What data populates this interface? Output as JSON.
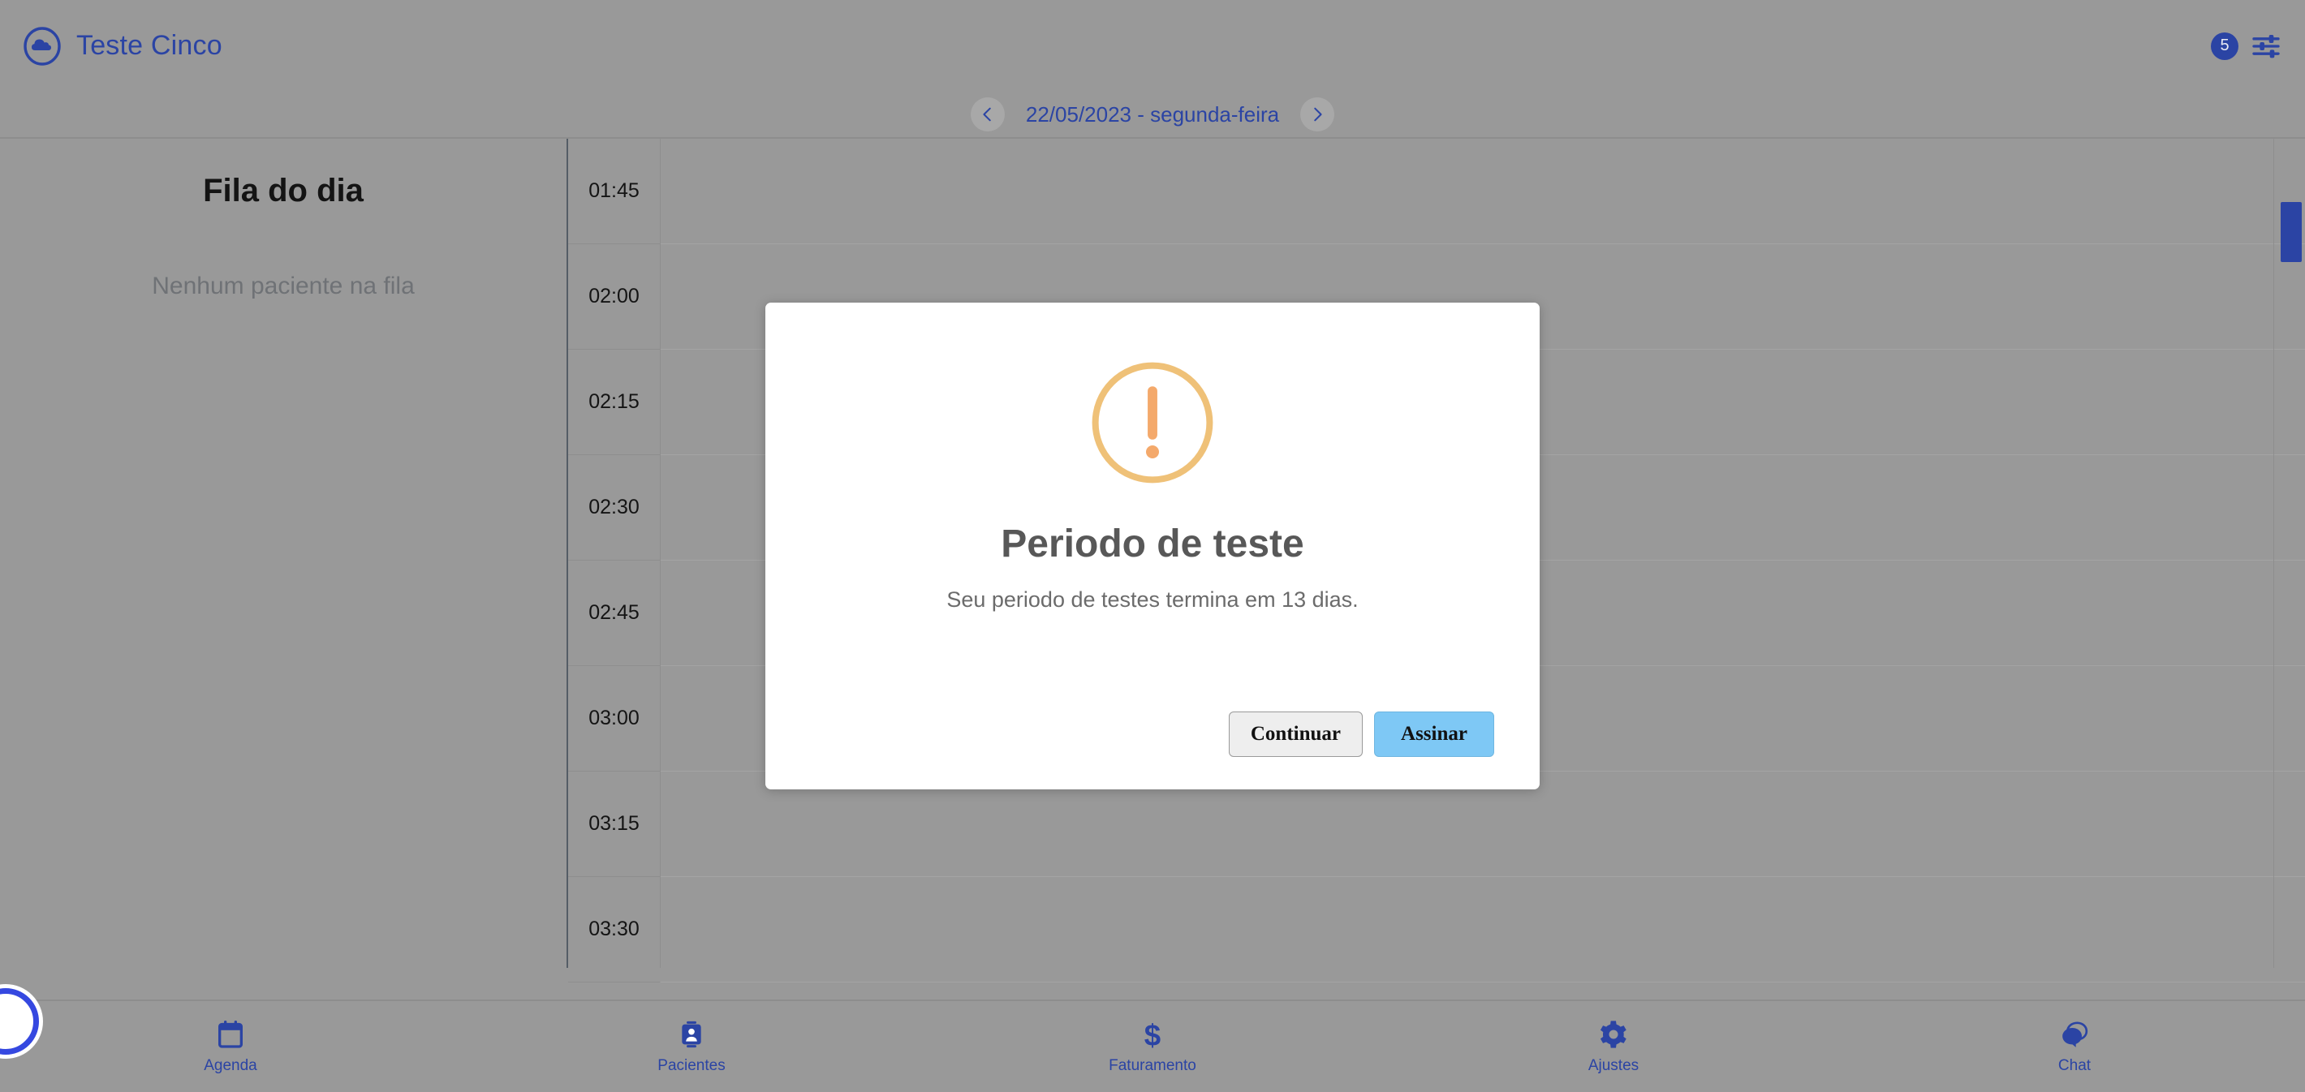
{
  "colors": {
    "page_bg": "#999999",
    "brand_blue": "#2b44a4",
    "accent_blue": "#3548e0",
    "warn_orange": "#efc178",
    "primary_button": "#7ec8f5",
    "scrollbar": "#2b44a4"
  },
  "header": {
    "logo_icon": "cloud-circle-icon",
    "title": "Teste Cinco",
    "notification_count": "5",
    "settings_icon": "tune-sliders-icon"
  },
  "datebar": {
    "prev_icon": "chevron-left-icon",
    "next_icon": "chevron-right-icon",
    "current_date": "22/05/2023 - segunda-feira"
  },
  "queue": {
    "title": "Fila do dia",
    "empty_message": "Nenhum paciente na fila"
  },
  "schedule": {
    "time_slots": [
      "01:45",
      "02:00",
      "02:15",
      "02:30",
      "02:45",
      "03:00",
      "03:15",
      "03:30"
    ]
  },
  "bottom_nav": {
    "items": [
      {
        "label": "Agenda",
        "icon": "calendar-icon"
      },
      {
        "label": "Pacientes",
        "icon": "contact-card-icon"
      },
      {
        "label": "Faturamento",
        "icon": "dollar-sign-icon"
      },
      {
        "label": "Ajustes",
        "icon": "gear-icon"
      },
      {
        "label": "Chat",
        "icon": "chat-bubbles-icon"
      }
    ]
  },
  "fab": {
    "icon": "floating-action-circle-icon"
  },
  "modal": {
    "icon": "warning-exclamation-icon",
    "title": "Periodo de teste",
    "message": "Seu periodo de testes termina em 13 dias.",
    "secondary_button": "Continuar",
    "primary_button": "Assinar"
  }
}
